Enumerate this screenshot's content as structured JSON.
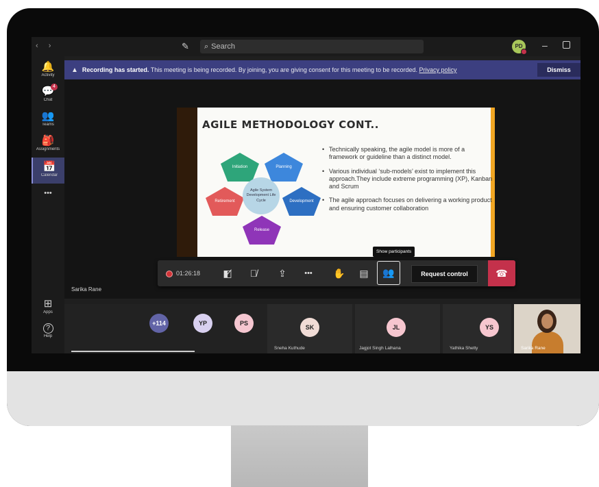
{
  "titlebar": {
    "search_placeholder": "Search",
    "user_initials": "PD"
  },
  "rail": [
    {
      "label": "Activity",
      "icon": "bell-icon",
      "glyph": "🔔"
    },
    {
      "label": "Chat",
      "icon": "chat-icon",
      "glyph": "💬",
      "badge": "4"
    },
    {
      "label": "Teams",
      "icon": "teams-icon",
      "glyph": "👥"
    },
    {
      "label": "Assignments",
      "icon": "assignments-icon",
      "glyph": "🎒"
    },
    {
      "label": "Calendar",
      "icon": "calendar-icon",
      "glyph": "📅"
    },
    {
      "label": "",
      "icon": "more-icon",
      "glyph": "•••"
    },
    {
      "label": "Apps",
      "icon": "apps-icon",
      "glyph": "⊞"
    },
    {
      "label": "Help",
      "icon": "help-icon",
      "glyph": "?"
    }
  ],
  "banner": {
    "bold": "Recording has started.",
    "text": " This meeting is being recorded. By joining, you are giving consent for this meeting to be recorded. ",
    "link": "Privacy policy",
    "dismiss": "Dismiss"
  },
  "slide": {
    "title": "AGILE METHODOLOGY CONT..",
    "diagram": {
      "center": "Agile System Development Life Cycle",
      "stages": [
        "Initiation",
        "Planning",
        "Development",
        "Release",
        "Retirement"
      ]
    },
    "bullets": [
      "Technically speaking, the agile model is more of a framework or guideline than a distinct model.",
      "Various individual ‘sub-models’ exist to implement this approach.They include extreme programming (XP), Kanban and Scrum",
      "The agile approach focuses on delivering a working product and ensuring customer collaboration"
    ]
  },
  "toolbar": {
    "timer": "01:26:18",
    "request_control": "Request control",
    "tooltip": "Show participants"
  },
  "presenter_name": "Sarika Rane",
  "participants": {
    "overflow": "+114",
    "pills": [
      {
        "initials": "YP",
        "color": "#d8d0f0"
      },
      {
        "initials": "PS",
        "color": "#f5c6d0"
      }
    ],
    "tiles": [
      {
        "initials": "SK",
        "name": "Sneha Kuthude",
        "color": "#f1dcd6"
      },
      {
        "initials": "JL",
        "name": "Jagjot Singh Lalhana",
        "color": "#f6c6cf"
      },
      {
        "initials": "YS",
        "name": "Yathika Shetty",
        "color": "#f6c6cf"
      }
    ],
    "video_name": "Sarika Rane"
  },
  "colors": {
    "banner": "#3c3f80",
    "hangup": "#c4314b",
    "overflow_pill": "#6264a7",
    "slide_accent": "#f1a623"
  }
}
